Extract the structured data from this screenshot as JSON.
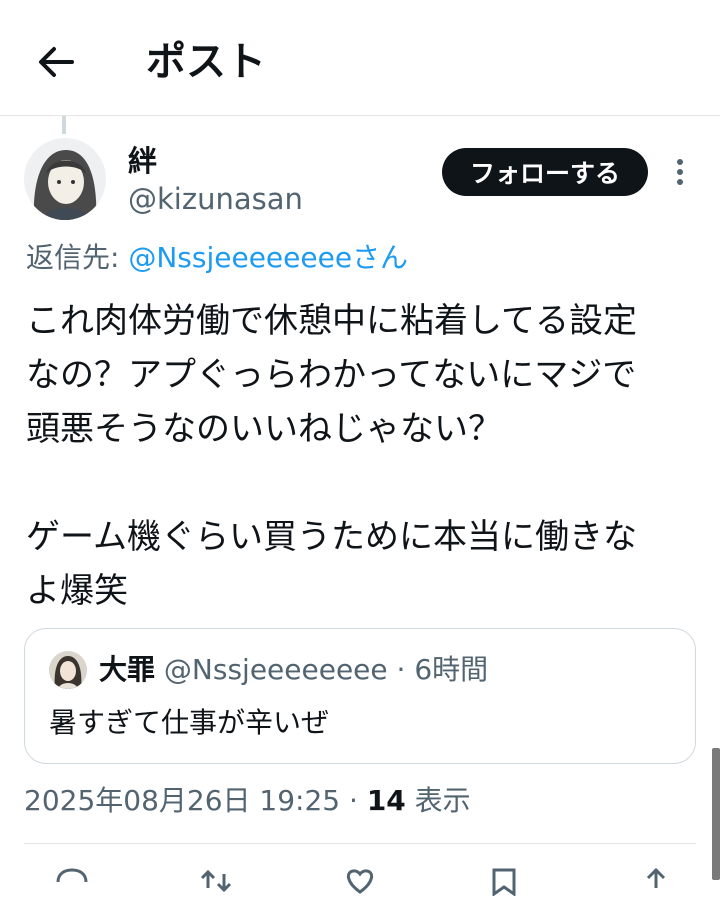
{
  "header": {
    "title": "ポスト",
    "back_icon": "arrow-left-icon"
  },
  "post": {
    "author": {
      "name": "絆",
      "handle": "@kizunasan"
    },
    "follow_label": "フォローする",
    "more_icon": "more-vertical-icon",
    "reply_to": {
      "prefix": "返信先: ",
      "mention": "@Nssjeeeeeeeeさん"
    },
    "text_lines": [
      "これ肉体労働で休憩中に粘着してる設定",
      "なの？アプぐっらわかってないにマジで",
      "頭悪そうなのいいねじゃない？",
      "",
      "ゲーム機ぐらい買うために本当に働きな",
      "よ爆笑"
    ],
    "quote": {
      "name": "大罪",
      "handle_time": "@Nssjeeeeeeee · 6時間",
      "text": "暑すぎて仕事が辛いぜ"
    },
    "timestamp": "2025年08月26日 19:25",
    "separator": " · ",
    "views_count": "14",
    "views_label": " 表示"
  },
  "actions": [
    "reply-icon",
    "repost-icon",
    "like-icon",
    "bookmark-icon",
    "share-icon"
  ],
  "colors": {
    "text": "#0f1419",
    "secondary": "#536471",
    "link": "#1d9bf0",
    "border": "#cfd9de"
  }
}
